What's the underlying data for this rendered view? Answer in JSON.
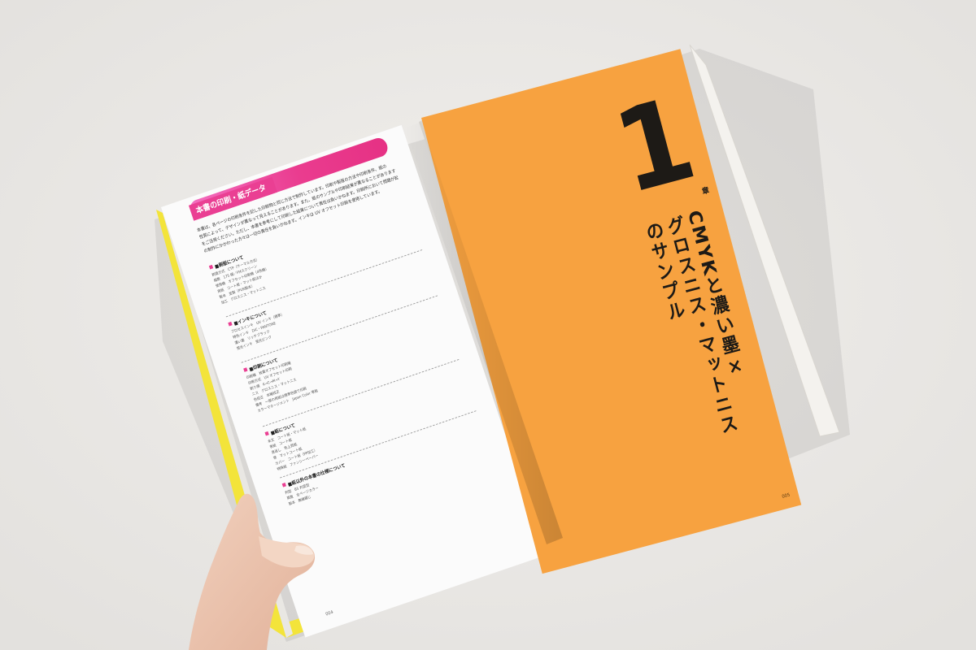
{
  "left_page": {
    "header_label": "本書の印刷・紙データ",
    "intro_lines": [
      "本書は、各ページの印刷条件を記した印刷物と同じ方法で制作しています。印刷や製版の方法や印刷条件、紙の",
      "性質によって、デザインが異なって見えることがあります。また、紙のサンプルや印刷結果が異なることがありますことをご了承の上、本書",
      "をご活用ください。ただし、本書を参考にして印刷した結果について責任は負いかねます。印刷所において問題が起きた場合、小社ならびに本書",
      "の制作にかかわった方々は一切の責任を負いかねます。インキは UV オフセット印刷を使用しています。"
    ],
    "sections": [
      {
        "heading": "■刷版について",
        "lines": [
          "刷版方式　CTP（サーマル方式）",
          "線数　175 線／FMスクリーン",
          "使用機　オフセット印刷機（4色機）",
          "用紙　コート紙・マット紙ほか",
          "製本　並製（PUR製本）",
          "加工　グロスニス・マットニス"
        ]
      },
      {
        "heading": "■インキについて",
        "lines": [
          "プロセスインキ　UV インキ（標準）",
          "特色インキ　DIC・PANTONE",
          "濃い墨　リッチブラック",
          "蛍光インキ　蛍光ピンク"
        ]
      },
      {
        "heading": "■印刷について",
        "lines": [
          "印刷機　枚葉オフセット印刷機",
          "印刷方式　UV オフセット印刷",
          "刷り順　K→C→M→Y",
          "ニス　グロスニス・マットニス",
          "色校正　本機校正",
          "備考　一部の用紙は標準色調で印刷",
          "カラーマネージメント　Japan Color 準拠"
        ]
      },
      {
        "heading": "■紙について",
        "lines": [
          "本文　コート紙・マット紙",
          "表紙　コート紙",
          "見返し　色上質紙",
          "帯　マットコート紙",
          "カバー　コート紙（PP加工）",
          "特殊紙　ファンシーペーパー"
        ]
      },
      {
        "heading": "■紙以外の本書の仕様について",
        "lines": [
          "判型　B5 判変型",
          "頁数　全ページカラー",
          "製本　無線綴じ"
        ]
      }
    ],
    "page_number": "004"
  },
  "right_page": {
    "chapter_number": "1",
    "chapter_kanji": "章",
    "title_lines": [
      "CMYKと濃い墨×",
      "グロスニス・マットニス",
      "のサンプル"
    ],
    "page_number": "005"
  },
  "colors": {
    "background": "#eceae7",
    "orange_page": "#f7a240",
    "pink_accent": "#ea3f93",
    "yellow_cover": "#f3e43a",
    "ink": "#1d1a16"
  }
}
